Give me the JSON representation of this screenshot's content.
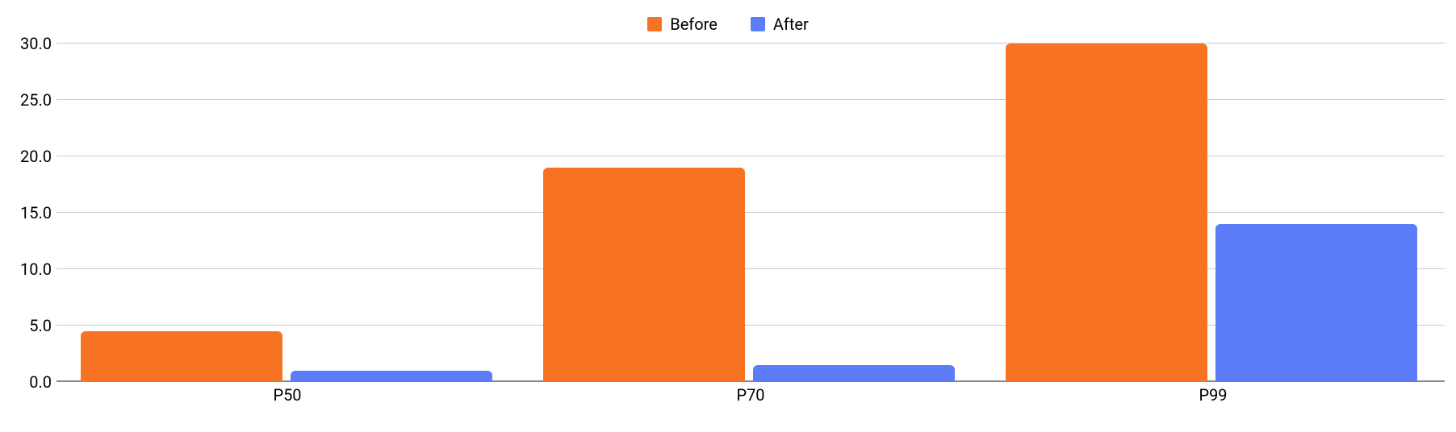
{
  "chart_data": {
    "type": "bar",
    "categories": [
      "P50",
      "P70",
      "P99"
    ],
    "series": [
      {
        "name": "Before",
        "values": [
          4.5,
          19.0,
          30.0
        ],
        "color": "#f77323"
      },
      {
        "name": "After",
        "values": [
          1.0,
          1.5,
          14.0
        ],
        "color": "#5c7cfa"
      }
    ],
    "ylim": [
      0.0,
      30.0
    ],
    "yticks": [
      0.0,
      5.0,
      10.0,
      15.0,
      20.0,
      25.0,
      30.0
    ],
    "title": "",
    "xlabel": "",
    "ylabel": ""
  },
  "legend": {
    "items": [
      {
        "label": "Before",
        "color": "#f77323"
      },
      {
        "label": "After",
        "color": "#5c7cfa"
      }
    ]
  },
  "yaxis_labels": [
    "0.0",
    "5.0",
    "10.0",
    "15.0",
    "20.0",
    "25.0",
    "30.0"
  ],
  "xaxis_labels": [
    "P50",
    "P70",
    "P99"
  ]
}
